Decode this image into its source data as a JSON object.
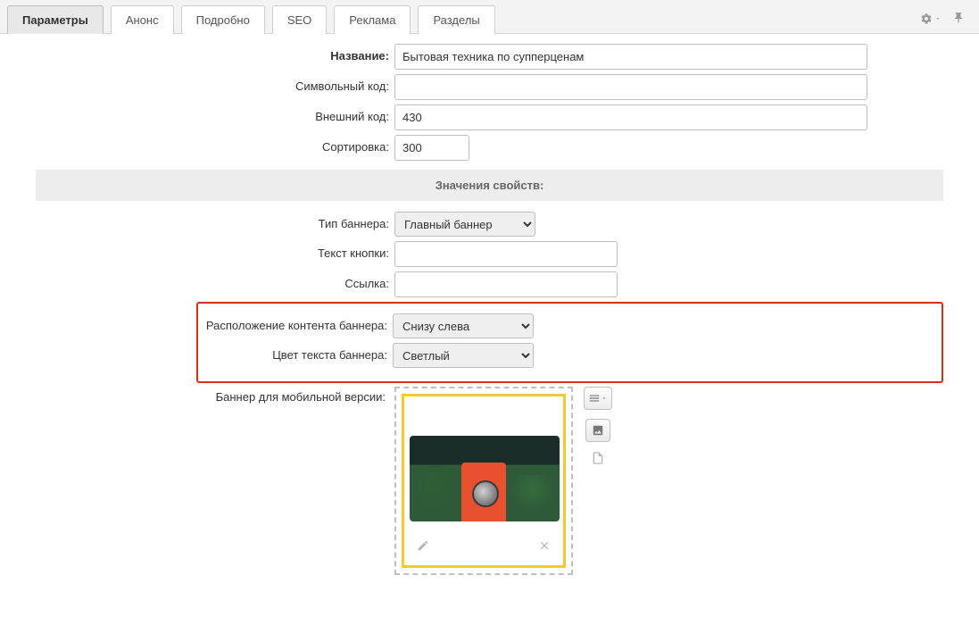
{
  "tabs": {
    "params": "Параметры",
    "anons": "Анонс",
    "detail": "Подробно",
    "seo": "SEO",
    "ad": "Реклама",
    "sections": "Разделы"
  },
  "fields": {
    "name_label": "Название:",
    "name_value": "Бытовая техника по супперценам",
    "symbol_label": "Символьный код:",
    "symbol_value": "",
    "external_label": "Внешний код:",
    "external_value": "430",
    "sort_label": "Сортировка:",
    "sort_value": "300"
  },
  "section_header": "Значения свойств:",
  "props": {
    "banner_type_label": "Тип баннера:",
    "banner_type_value": "Главный баннер",
    "button_text_label": "Текст кнопки:",
    "button_text_value": "",
    "link_label": "Ссылка:",
    "link_value": "",
    "content_pos_label": "Расположение контента баннера:",
    "content_pos_value": "Снизу слева",
    "text_color_label": "Цвет текста баннера:",
    "text_color_value": "Светлый",
    "mobile_banner_label": "Баннер для мобильной версии:"
  }
}
